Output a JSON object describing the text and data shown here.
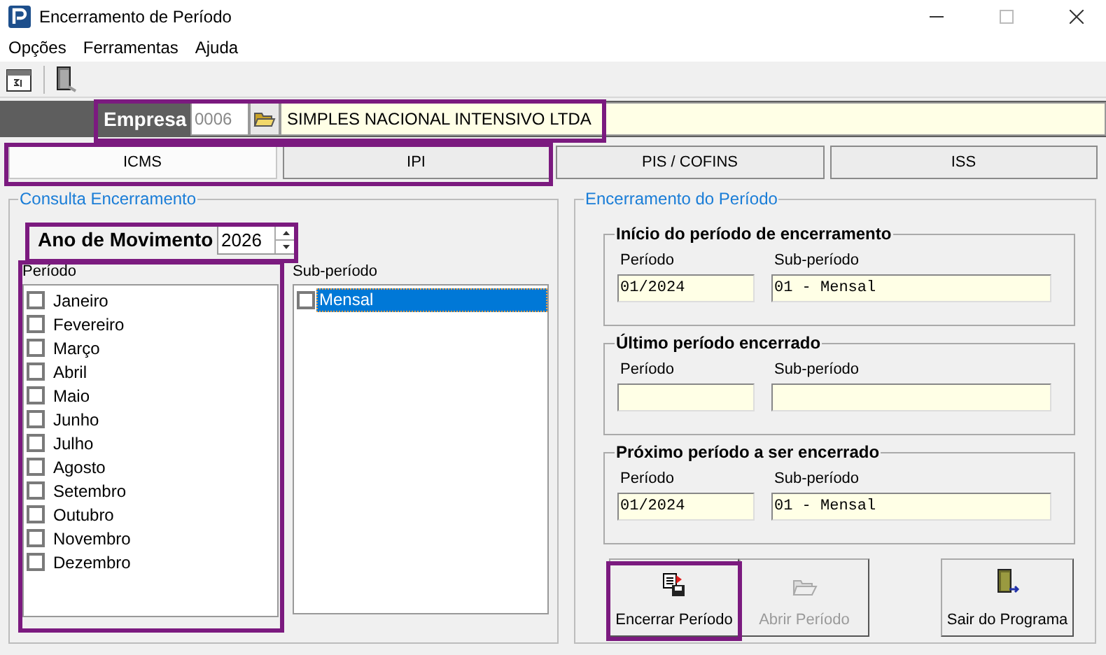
{
  "window": {
    "title": "Encerramento de Período"
  },
  "menu": [
    "Opções",
    "Ferramentas",
    "Ajuda"
  ],
  "empresa": {
    "label": "Empresa",
    "code": "0006",
    "name": "SIMPLES NACIONAL INTENSIVO LTDA"
  },
  "tabs": [
    {
      "label": "ICMS",
      "selected": true
    },
    {
      "label": "IPI",
      "selected": false
    },
    {
      "label": "PIS / COFINS",
      "selected": false
    },
    {
      "label": "ISS",
      "selected": false
    }
  ],
  "consulta": {
    "title": "Consulta Encerramento",
    "year_label": "Ano de Movimento",
    "year": "2026",
    "period_label": "Período",
    "periods": [
      {
        "label": "Janeiro",
        "checked": false
      },
      {
        "label": "Fevereiro",
        "checked": false
      },
      {
        "label": "Março",
        "checked": false
      },
      {
        "label": "Abril",
        "checked": false
      },
      {
        "label": "Maio",
        "checked": false
      },
      {
        "label": "Junho",
        "checked": false
      },
      {
        "label": "Julho",
        "checked": false
      },
      {
        "label": "Agosto",
        "checked": false
      },
      {
        "label": "Setembro",
        "checked": false
      },
      {
        "label": "Outubro",
        "checked": false
      },
      {
        "label": "Novembro",
        "checked": false
      },
      {
        "label": "Dezembro",
        "checked": false
      }
    ],
    "sub_period_label": "Sub-período",
    "sub_periods": [
      {
        "label": "Mensal",
        "checked": false,
        "selected": true
      }
    ]
  },
  "encerramento": {
    "title": "Encerramento do Período",
    "groups": [
      {
        "title": "Início do período de encerramento",
        "period_label": "Período",
        "period": "01/2024",
        "sub_label": "Sub-período",
        "sub": "01 - Mensal"
      },
      {
        "title": "Último período encerrado",
        "period_label": "Período",
        "sub_label": "Sub-período"
      },
      {
        "title": "Próximo período a ser encerrado",
        "period_label": "Período",
        "period": "01/2024",
        "sub_label": "Sub-período",
        "sub": "01 - Mensal"
      }
    ],
    "buttons": [
      {
        "kind": "close",
        "label": "Encerrar Período",
        "disabled": false
      },
      {
        "kind": "open",
        "label": "Abrir Período",
        "disabled": true
      },
      {
        "kind": "exit",
        "label": "Sair do Programa",
        "disabled": false
      }
    ]
  }
}
